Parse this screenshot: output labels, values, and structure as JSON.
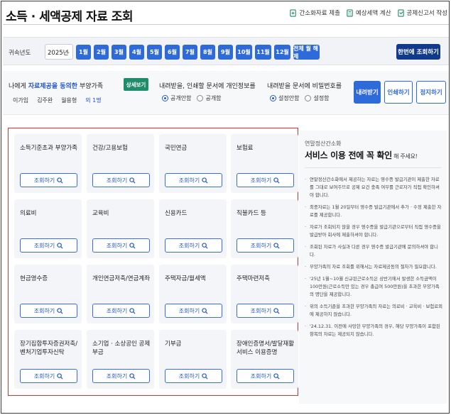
{
  "header": {
    "title": "소득 · 세액공제 자료 조회",
    "links": [
      {
        "label": "간소화자료 제출",
        "icon": "document-submit-icon"
      },
      {
        "label": "예상세액 계산",
        "icon": "calculator-icon"
      },
      {
        "label": "공제신고서 작성",
        "icon": "form-write-icon"
      }
    ]
  },
  "yearbar": {
    "label": "귀속년도",
    "year_value": "2025년",
    "months": [
      "1월",
      "2월",
      "3월",
      "4월",
      "5월",
      "6월",
      "7월",
      "8월",
      "9월",
      "10월",
      "11월",
      "12월"
    ],
    "all_months_label": "전체 월 해제",
    "search_all_label": "한번에 조회하기"
  },
  "consent": {
    "prefix": "나에게 ",
    "highlight": "자료제공을 동의한",
    "suffix": " 부양가족",
    "detail_button": "상세보기",
    "dependents": [
      "이가임",
      "김주완",
      "월용형"
    ],
    "more": "외 1명"
  },
  "option_personal": {
    "title": "내려받을, 인쇄할 문서에 개인정보를",
    "choices": [
      "공개안함",
      "공개함"
    ],
    "selected": 0
  },
  "option_password": {
    "title": "내려받을 문서에 비밀번호를",
    "choices": [
      "설정안함",
      "설정함"
    ],
    "selected": 0
  },
  "actions": {
    "download": "내려받기",
    "print": "인쇄하기",
    "email": "정지하기"
  },
  "cards": [
    {
      "label": "소득기준초과 부양가족",
      "button": "조회하기"
    },
    {
      "label": "건강/고용보험",
      "button": "조회하기"
    },
    {
      "label": "국민연금",
      "button": "조회하기"
    },
    {
      "label": "보험료",
      "button": "조회하기"
    },
    {
      "label": "의료비",
      "button": "조회하기"
    },
    {
      "label": "교육비",
      "button": "조회하기"
    },
    {
      "label": "신용카드",
      "button": "조회하기"
    },
    {
      "label": "직불카드 등",
      "button": "조회하기"
    },
    {
      "label": "현금영수증",
      "button": "조회하기"
    },
    {
      "label": "개인연금저축/연금계좌",
      "button": "조회하기"
    },
    {
      "label": "주택자금/월세액",
      "button": "조회하기"
    },
    {
      "label": "주택마련저축",
      "button": "조회하기"
    },
    {
      "label": "장기집합투자증권저축/벤처기업투자신탁",
      "button": "조회하기"
    },
    {
      "label": "소기업 · 소상공인 공제부금",
      "button": "조회하기"
    },
    {
      "label": "기부금",
      "button": "조회하기"
    },
    {
      "label": "장애인증명서/발달재활서비스 이용증명",
      "button": "조회하기"
    }
  ],
  "notice": {
    "subtitle": "연말정산간소화",
    "title": "서비스 이용 전에 꼭 확인",
    "title_suffix": " 해 주세요!",
    "items": [
      "연말정산간소화에서 제공하는 자료는 영수증 발급기관이 제출한 자료를 그대로 보여주므로 공제 요건 충족 여부를 근로자가 직접 확인하셔야 합니다.",
      "최종자료는 1월 20일부터 영수증 발급기관에서 추가 · 수정 제출한 자료를 제공합니다.",
      "자료가 조회되지 않을 경우 영수증을 발급기관으로부터 직접 영수증을 발급받아 회사에 제출하셔야 합니다.",
      "조회된 자료가 사실과 다른 경우 영수증 발급기관에 문의하셔야 합니다.",
      "부양가족의 자료 조회를 위해서는 자료제공동의 절차가 필요합니다.",
      "'25년 1월~10월 신규된근로소득은 상반기에서 발생한 소득금액이 100만원(근로소득만 있는 경우 총급여 500만원)을 초과한 부양가족의 명단을 제공합니다.",
      "위의 소득기준을 초과한 부양가족의 자료는 의료비 · 교육비 · 보험료외에 제공하지 않습니다.",
      "'24.12.31. 이전에 사망한 부양가족의 경우, 해당 부양가족이 포함된 항목의 자료는 제공되지 않습니다."
    ]
  }
}
